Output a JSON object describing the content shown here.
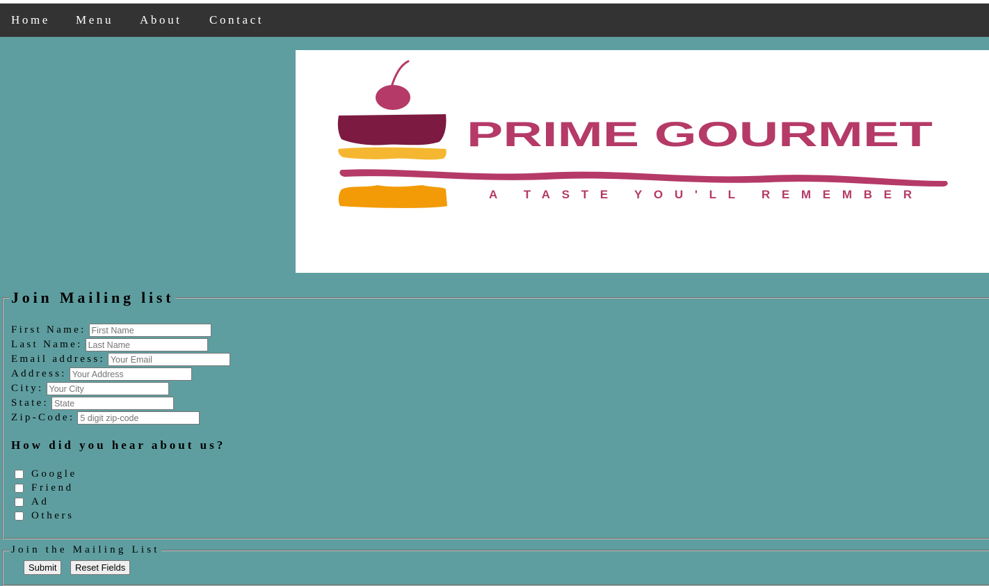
{
  "nav": {
    "items": [
      {
        "label": "Home"
      },
      {
        "label": "Menu"
      },
      {
        "label": "About"
      },
      {
        "label": "Contact"
      }
    ]
  },
  "logo": {
    "title": "PRIME GOURMET",
    "tagline": "A TASTE YOU'LL REMEMBER",
    "colors": {
      "brand": "#b53a67",
      "dark": "#7d1a41",
      "yellow": "#f5b731",
      "orange": "#f29b07"
    }
  },
  "form": {
    "legend": "Join Mailing list",
    "fields": [
      {
        "label": "First Name:",
        "placeholder": "First Name",
        "value": ""
      },
      {
        "label": "Last Name:",
        "placeholder": "Last Name",
        "value": ""
      },
      {
        "label": "Email address:",
        "placeholder": "Your Email",
        "value": ""
      },
      {
        "label": "Address:",
        "placeholder": "Your Address",
        "value": ""
      },
      {
        "label": "City:",
        "placeholder": "Your City",
        "value": ""
      },
      {
        "label": "State:",
        "placeholder": "State",
        "value": ""
      },
      {
        "label": "Zip-Code:",
        "placeholder": "5 digit zip-code",
        "value": ""
      }
    ],
    "hear_heading": "How did you hear about us?",
    "options": [
      {
        "label": "Google",
        "checked": false
      },
      {
        "label": "Friend",
        "checked": false
      },
      {
        "label": "Ad",
        "checked": false
      },
      {
        "label": "Others",
        "checked": false
      }
    ]
  },
  "submit_section": {
    "legend": "Join the Mailing List",
    "submit_label": "Submit",
    "reset_label": "Reset Fields"
  },
  "colors": {
    "page_bg": "#5f9ea0",
    "nav_bg": "#333333"
  }
}
